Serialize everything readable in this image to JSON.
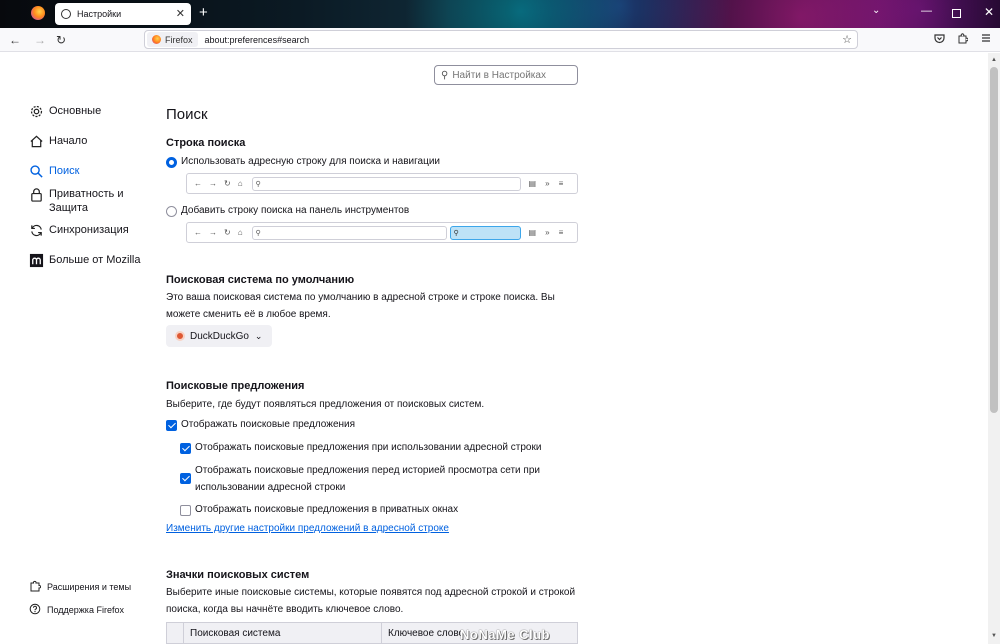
{
  "window": {
    "tab_title": "Настройки",
    "tab_close": "✕",
    "new_tab": "+",
    "list_all_tabs": "⌄",
    "minimize": "—",
    "close": "✕"
  },
  "navbar": {
    "back": "←",
    "forward": "→",
    "reload": "↻",
    "identity_label": "Firefox",
    "url": "about:preferences#search",
    "bookmark_star": "☆"
  },
  "search_prefs": {
    "placeholder": "Найти в Настройках"
  },
  "sidebar": {
    "items": [
      {
        "label": "Основные",
        "icon": "gear-icon"
      },
      {
        "label": "Начало",
        "icon": "home-icon"
      },
      {
        "label": "Поиск",
        "icon": "search-icon"
      },
      {
        "label": "Приватность и Защита",
        "icon": "lock-icon"
      },
      {
        "label": "Синхронизация",
        "icon": "sync-icon"
      },
      {
        "label": "Больше от Mozilla",
        "icon": "mozilla-icon"
      }
    ],
    "footer": [
      {
        "label": "Расширения и темы",
        "icon": "puzzle-icon"
      },
      {
        "label": "Поддержка Firefox",
        "icon": "help-icon"
      }
    ]
  },
  "main": {
    "title": "Поиск",
    "search_bar": {
      "heading": "Строка поиска",
      "option_address": "Использовать адресную строку для поиска и навигации",
      "option_toolbar": "Добавить строку поиска на панель инструментов",
      "selected": "address"
    },
    "default_engine": {
      "heading": "Поисковая система по умолчанию",
      "description": "Это ваша поисковая система по умолчанию в адресной строке и строке поиска. Вы можете сменить её в любое время.",
      "engine": "DuckDuckGo"
    },
    "suggestions": {
      "heading": "Поисковые предложения",
      "description": "Выберите, где будут появляться предложения от поисковых систем.",
      "show_suggestions": "Отображать поисковые предложения",
      "in_address_bar": "Отображать поисковые предложения при использовании адресной строки",
      "before_history": "Отображать поисковые предложения перед историей просмотра сети при использовании адресной строки",
      "in_private": "Отображать поисковые предложения в приватных окнах",
      "checked": {
        "show_suggestions": true,
        "in_address_bar": true,
        "before_history": true,
        "in_private": false
      },
      "change_link": "Изменить другие настройки предложений в адресной строке"
    },
    "shortcuts": {
      "heading": "Значки поисковых систем",
      "description": "Выберите иные поисковые системы, которые появятся под адресной строкой и строкой поиска, когда вы начнёте вводить ключевое слово.",
      "col_engine": "Поисковая система",
      "col_keyword": "Ключевое слово"
    }
  },
  "watermark": "NoNaMe Club",
  "colors": {
    "accent": "#0061e0",
    "search_highlight": "#bde2f7"
  }
}
